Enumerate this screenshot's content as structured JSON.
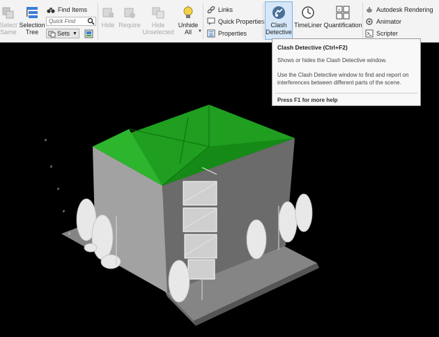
{
  "ribbon": {
    "select_same": "Select Same",
    "selection_tree": {
      "line1": "Selection",
      "line2": "Tree"
    },
    "find_items": "Find Items",
    "quick_find_placeholder": "Quick Find",
    "sets": "Sets",
    "hide": "Hide",
    "require": "Require",
    "hide_unselected": {
      "line1": "Hide",
      "line2": "Unselected"
    },
    "unhide_all": {
      "line1": "Unhide",
      "line2": "All"
    },
    "links": "Links",
    "quick_properties": "Quick Properties",
    "properties": "Properties",
    "clash_detective": {
      "line1": "Clash",
      "line2": "Detective"
    },
    "timeliner": "TimeLiner",
    "quantification": "Quantification",
    "autodesk_rendering": "Autodesk Rendering",
    "animator": "Animator",
    "scripter": "Scripter"
  },
  "tooltip": {
    "title": "Clash Detective (Ctrl+F2)",
    "subtitle": "Shows or hides the Clash Detective window.",
    "description": "Use the Clash Detective window to find and report on interferences between different parts of the scene.",
    "help": "Press F1 for more help"
  },
  "colors": {
    "roof": "#1e9d1e",
    "wall_light": "#a3a3a3",
    "wall_dark": "#6b6b6b",
    "ground": "#858585",
    "background": "#000000"
  }
}
